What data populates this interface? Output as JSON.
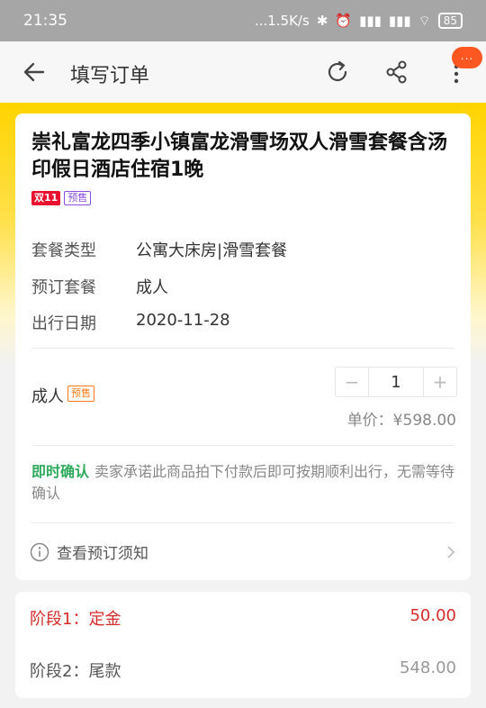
{
  "status_bar": {
    "time": "21:35",
    "network_speed": "...1.5K/s",
    "battery": "85"
  },
  "navbar": {
    "title": "填写订单",
    "badge": "..."
  },
  "product": {
    "title": "崇礼富龙四季小镇富龙滑雪场双人滑雪套餐含汤印假日酒店住宿1晚",
    "tag_double11": "双11",
    "tag_presale": "预售"
  },
  "details": [
    {
      "label": "套餐类型",
      "value": "公寓大床房|滑雪套餐"
    },
    {
      "label": "预订套餐",
      "value": "成人"
    },
    {
      "label": "出行日期",
      "value": "2020-11-28"
    }
  ],
  "quantity": {
    "label": "成人",
    "tag": "预售",
    "minus": "−",
    "value": "1",
    "plus": "+",
    "unit_price": "单价：¥598.00"
  },
  "confirm": {
    "tag": "即时确认",
    "text": "卖家承诺此商品拍下付款后即可按期顺利出行，无需等待确认"
  },
  "notice": {
    "label": "查看预订须知"
  },
  "stages": [
    {
      "label": "阶段1：定金",
      "amount": "50.00"
    },
    {
      "label": "阶段2：尾款",
      "amount": "548.00"
    }
  ],
  "colors": {
    "accent_yellow": "#ffd400",
    "price_red": "#d62b2b",
    "confirm_green": "#2eaa5c",
    "presale_purple": "#8a4fe0",
    "presale_orange": "#ff7a1a"
  }
}
